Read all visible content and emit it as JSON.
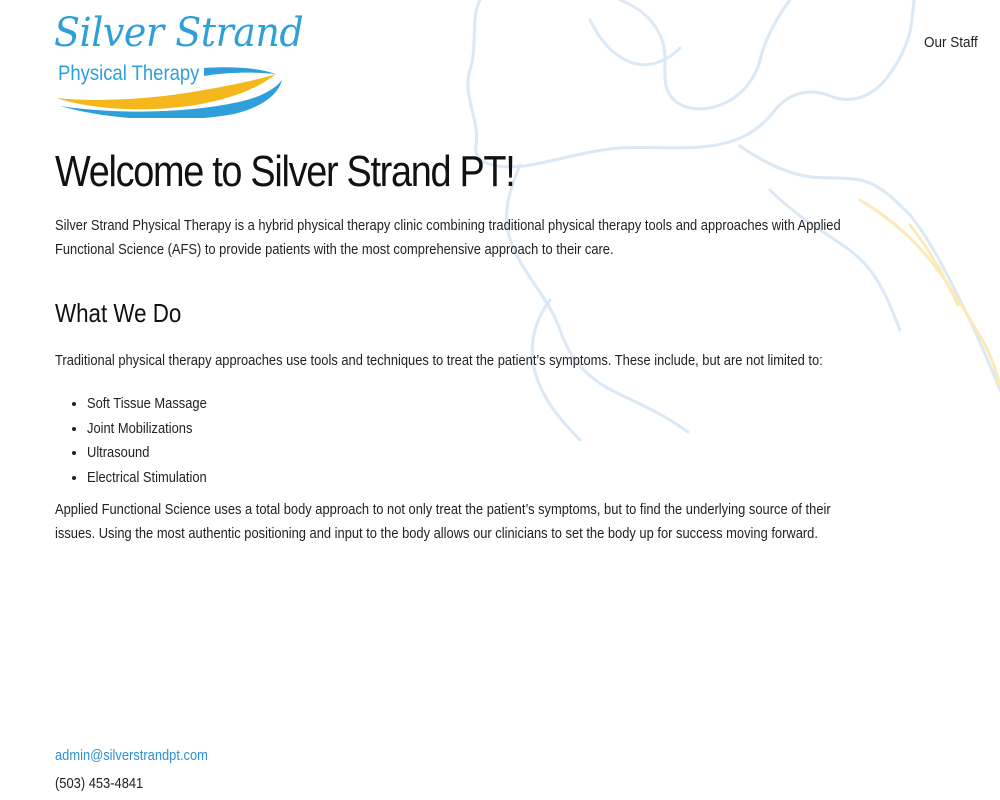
{
  "brand": {
    "title": "Silver Strand",
    "subtitle": "Physical Therapy",
    "colors": {
      "blue": "#2e9fd8",
      "gold": "#f5b81c"
    }
  },
  "nav": {
    "items": [
      {
        "label": "Our Staff"
      }
    ]
  },
  "main": {
    "heading": "Welcome to Silver Strand PT!",
    "intro": "Silver Strand Physical Therapy is a hybrid physical therapy clinic combining traditional physical therapy tools and approaches with Applied Functional Science (AFS) to provide patients with the most comprehensive approach to their care.",
    "section": {
      "heading": "What We Do",
      "traditional": "Traditional physical therapy approaches use tools and techniques to treat the patient’s symptoms. These include, but are not limited to:",
      "list": [
        "Soft Tissue Massage",
        "Joint Mobilizations",
        "Ultrasound",
        "Electrical Stimulation"
      ],
      "afs": "Applied Functional Science uses a total body approach to not only treat the patient’s symptoms, but to find the underlying source of their issues. Using the most authentic positioning and input to the body allows our clinicians to set the body up for success moving forward."
    }
  },
  "footer": {
    "email": "admin@silverstrandpt.com",
    "phone": "(503) 453-4841"
  }
}
